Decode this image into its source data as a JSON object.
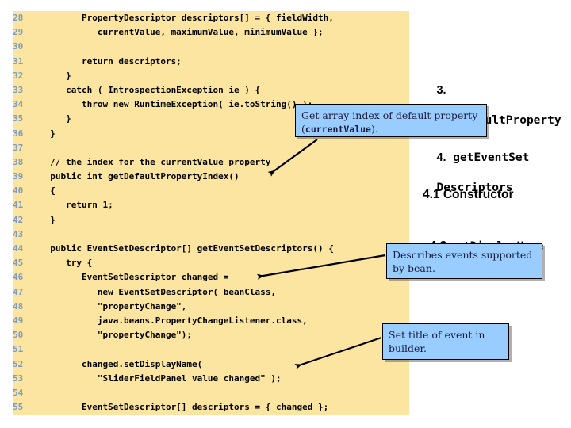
{
  "code": {
    "language": "java",
    "background_color": "#fce5a1",
    "line_number_color": "#7d9bc1",
    "first_line_number": 28,
    "lines": [
      {
        "n": "28",
        "text": "        PropertyDescriptor descriptors[] = { fieldWidth,"
      },
      {
        "n": "29",
        "text": "           currentValue, maximumValue, minimumValue };"
      },
      {
        "n": "30",
        "text": ""
      },
      {
        "n": "31",
        "text": "        return descriptors;"
      },
      {
        "n": "32",
        "text": "     }"
      },
      {
        "n": "33",
        "text": "     catch ( IntrospectionException ie ) {"
      },
      {
        "n": "34",
        "text": "        throw new RuntimeException( ie.toString() );"
      },
      {
        "n": "35",
        "text": "     }"
      },
      {
        "n": "36",
        "text": "  }"
      },
      {
        "n": "37",
        "text": ""
      },
      {
        "n": "38",
        "text": "  // the index for the currentValue property"
      },
      {
        "n": "39",
        "text": "  public int getDefaultPropertyIndex()"
      },
      {
        "n": "40",
        "text": "  {"
      },
      {
        "n": "41",
        "text": "     return 1;"
      },
      {
        "n": "42",
        "text": "  }"
      },
      {
        "n": "43",
        "text": ""
      },
      {
        "n": "44",
        "text": "  public EventSetDescriptor[] getEventSetDescriptors() {"
      },
      {
        "n": "45",
        "text": "     try {"
      },
      {
        "n": "46",
        "text": "        EventSetDescriptor changed ="
      },
      {
        "n": "47",
        "text": "           new EventSetDescriptor( beanClass,"
      },
      {
        "n": "48",
        "text": "           \"propertyChange\","
      },
      {
        "n": "49",
        "text": "           java.beans.PropertyChangeListener.class,"
      },
      {
        "n": "50",
        "text": "           \"propertyChange\");"
      },
      {
        "n": "51",
        "text": ""
      },
      {
        "n": "52",
        "text": "        changed.setDisplayName("
      },
      {
        "n": "53",
        "text": "           \"SliderFieldPanel value changed\" );"
      },
      {
        "n": "54",
        "text": ""
      },
      {
        "n": "55",
        "text": "        EventSetDescriptor[] descriptors = { changed };"
      }
    ]
  },
  "outline": {
    "heading_3": {
      "number": "3.",
      "name": "getDefaultProperty"
    },
    "heading_4": {
      "number": "4.",
      "name": "getEventSet",
      "name_line2": "Descriptors"
    },
    "heading_41": {
      "text": "4.1 Constructor"
    },
    "heading_42": {
      "number": "4.2",
      "name": "setDisplayName"
    }
  },
  "callouts": {
    "default_property": {
      "line1": "Get array index of default property",
      "code_term": "currentValue",
      "line2_suffix": ").",
      "line2_prefix": "("
    },
    "events": {
      "line1": "Describes events supported",
      "line2": "by bean."
    },
    "title": {
      "line1": "Set title of event in",
      "line2": "builder."
    }
  },
  "colors": {
    "code_background": "#fce5a1",
    "callout_background": "#99ccff",
    "line_number": "#7d9bc1",
    "page_background": "#ffffff"
  }
}
